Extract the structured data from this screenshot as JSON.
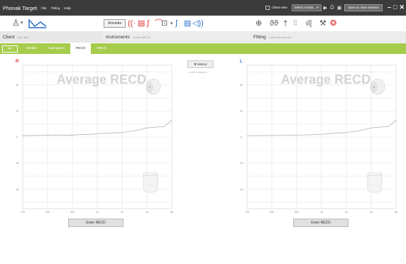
{
  "titlebar": {
    "app_title": "Phonak Target",
    "menus": [
      "File",
      "Fitting",
      "Help"
    ],
    "client_view_label": "Client view",
    "media_select": "Select media...",
    "save_close_label": "Save & close session"
  },
  "toolbar": {
    "simulate_label": "Simulate"
  },
  "sections": {
    "client_title": "Client",
    "client_name": "Test Test",
    "instruments_title": "Instruments",
    "instruments_model": "Audéo M90-R",
    "fitting_title": "Fitting",
    "fitting_situation": "Calm situation (0)"
  },
  "tabs": [
    "Details",
    "Audiogram",
    "RECD",
    "REUG"
  ],
  "active_tab": "RECD",
  "side_labels": {
    "right": "R",
    "left": "L"
  },
  "history": {
    "button_label": "History",
    "add_label": "Add to history"
  },
  "chart_data": [
    {
      "type": "line",
      "title": "Average RECD",
      "side": "R",
      "color": "#e03030",
      "x": [
        125,
        250,
        500,
        1000,
        2000,
        4000,
        8000
      ],
      "x_tick_labels": [
        "125",
        "250",
        "500",
        "1k",
        "2k",
        "4k",
        "8k"
      ],
      "y_tick_labels": [
        "40",
        "20",
        "0",
        "-20",
        "-40"
      ],
      "ylim": [
        -55,
        55
      ],
      "series": [
        {
          "style": "dashed",
          "color": "#444444",
          "points": [
            [
              125,
              1
            ],
            [
              200,
              1.2
            ],
            [
              300,
              1.3
            ],
            [
              500,
              1.5
            ],
            [
              800,
              2
            ]
          ]
        },
        {
          "style": "solid",
          "color": "#bbbbbb",
          "points": [
            [
              800,
              2
            ],
            [
              1200,
              2.8
            ],
            [
              1500,
              3
            ],
            [
              2000,
              3.4
            ],
            [
              3000,
              5
            ],
            [
              4000,
              7
            ],
            [
              5000,
              7.5
            ],
            [
              6500,
              8
            ],
            [
              8000,
              13
            ]
          ]
        }
      ],
      "enter_label": "Enter RECD"
    },
    {
      "type": "line",
      "title": "Average RECD",
      "side": "L",
      "color": "#3a6fd0",
      "x": [
        125,
        250,
        500,
        1000,
        2000,
        4000,
        8000
      ],
      "x_tick_labels": [
        "125",
        "250",
        "500",
        "1k",
        "2k",
        "4k",
        "8k"
      ],
      "y_tick_labels": [
        "40",
        "20",
        "0",
        "-20",
        "-40"
      ],
      "ylim": [
        -55,
        55
      ],
      "series": [
        {
          "style": "solid",
          "color": "#bbbbbb",
          "points": [
            [
              125,
              1
            ],
            [
              250,
              1.2
            ],
            [
              500,
              1.4
            ],
            [
              1000,
              2
            ],
            [
              1500,
              3
            ],
            [
              2000,
              3.4
            ],
            [
              3000,
              5
            ],
            [
              4000,
              7
            ],
            [
              5000,
              7.5
            ],
            [
              6500,
              8
            ],
            [
              8000,
              13
            ]
          ]
        }
      ],
      "enter_label": "Enter RECD"
    }
  ]
}
